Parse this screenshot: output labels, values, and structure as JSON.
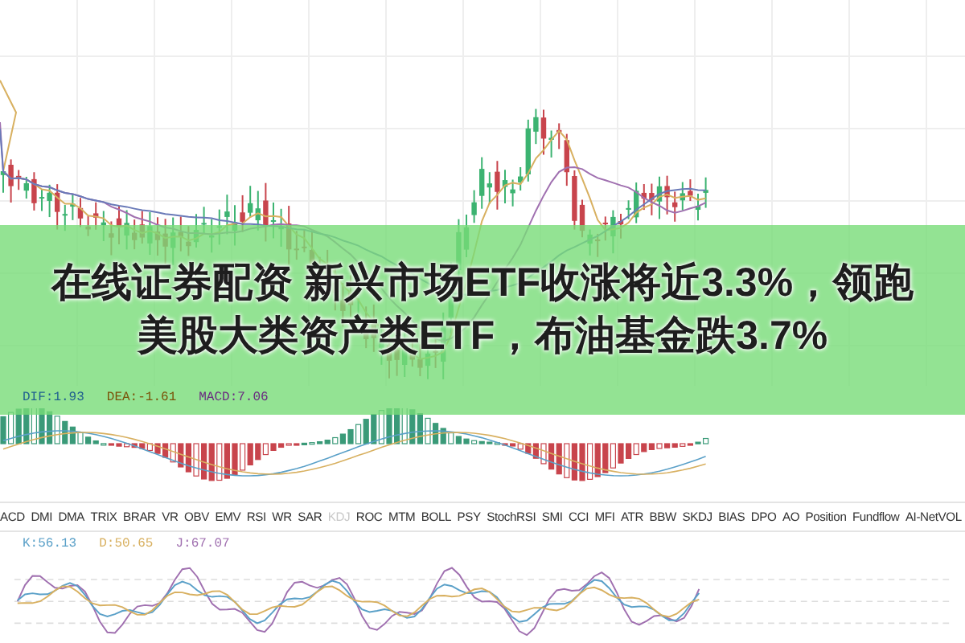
{
  "headline": "在线证券配资 新兴市场ETF收涨将近3.3%，领跑美股大类资产类ETF，布油基金跌3.7%",
  "macd_legend": [
    {
      "text": "DIF:1.93",
      "color": "#1f5f8f"
    },
    {
      "text": "DEA:-1.61",
      "color": "#7a5208"
    },
    {
      "text": "MACD:7.06",
      "color": "#6a2a80"
    }
  ],
  "tabs": [
    {
      "label": "ACD",
      "selected": false
    },
    {
      "label": "DMI",
      "selected": false
    },
    {
      "label": "DMA",
      "selected": false
    },
    {
      "label": "TRIX",
      "selected": false
    },
    {
      "label": "BRAR",
      "selected": false
    },
    {
      "label": "VR",
      "selected": false
    },
    {
      "label": "OBV",
      "selected": false
    },
    {
      "label": "EMV",
      "selected": false
    },
    {
      "label": "RSI",
      "selected": false
    },
    {
      "label": "WR",
      "selected": false
    },
    {
      "label": "SAR",
      "selected": false
    },
    {
      "label": "KDJ",
      "selected": true
    },
    {
      "label": "ROC",
      "selected": false
    },
    {
      "label": "MTM",
      "selected": false
    },
    {
      "label": "BOLL",
      "selected": false
    },
    {
      "label": "PSY",
      "selected": false
    },
    {
      "label": "StochRSI",
      "selected": false
    },
    {
      "label": "SMI",
      "selected": false
    },
    {
      "label": "CCI",
      "selected": false
    },
    {
      "label": "MFI",
      "selected": false
    },
    {
      "label": "ATR",
      "selected": false
    },
    {
      "label": "BBW",
      "selected": false
    },
    {
      "label": "SKDJ",
      "selected": false
    },
    {
      "label": "BIAS",
      "selected": false
    },
    {
      "label": "DPO",
      "selected": false
    },
    {
      "label": "AO",
      "selected": false
    },
    {
      "label": "Position",
      "selected": false
    },
    {
      "label": "Fundflow",
      "selected": false
    },
    {
      "label": "AI-NetVOL",
      "selected": false
    }
  ],
  "kdj_legend": [
    {
      "text": "K:56.13",
      "color": "#5aa0c8"
    },
    {
      "text": "D:50.65",
      "color": "#d8b060"
    },
    {
      "text": "J:67.07",
      "color": "#a070b0"
    }
  ]
}
